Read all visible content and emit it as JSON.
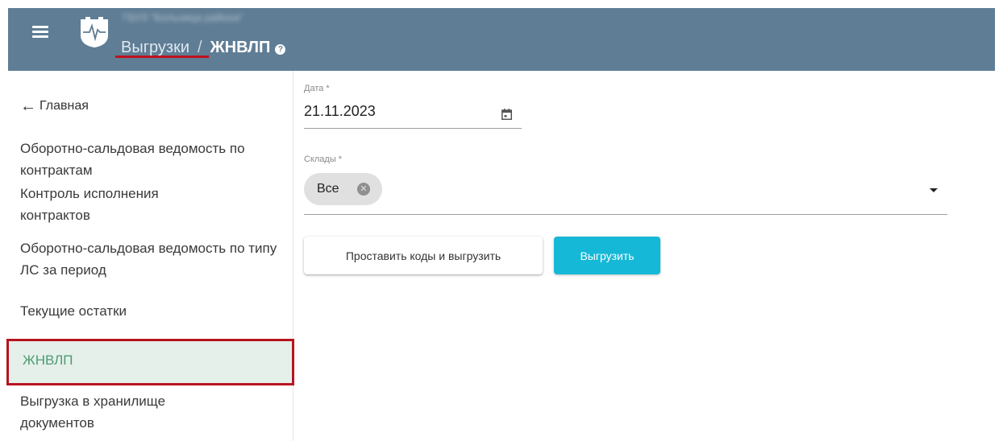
{
  "header": {
    "org_name": "ГБУЗ \"Больница района\"",
    "breadcrumb_parent": "Выгрузки",
    "breadcrumb_separator": "/",
    "breadcrumb_current": "ЖНВЛП",
    "help_symbol": "?",
    "background_color": "#5f7d95",
    "icons": [
      "menu-icon",
      "logo-icon",
      "help-icon"
    ]
  },
  "sidebar": {
    "back_label": "Главная",
    "items": [
      {
        "label": "Оборотно-сальдовая ведомость по контрактам"
      },
      {
        "label": "Контроль исполнения контрактов"
      },
      {
        "label": "Оборотно-сальдовая ведомость по типу ЛС за период"
      },
      {
        "label": "Текущие остатки"
      },
      {
        "label": "ЖНВЛП",
        "active": true
      },
      {
        "label": "Выгрузка в хранилище документов"
      }
    ],
    "active_color": "#4e9b72",
    "active_background": "#e5f0ea"
  },
  "form": {
    "date_label": "Дата *",
    "date_value": "21.11.2023",
    "warehouses_label": "Склады *",
    "warehouse_chip": "Все",
    "chip_remove_symbol": "✕",
    "btn_set_codes": "Проставить коды и выгрузить",
    "btn_export": "Выгрузить",
    "primary_color": "#15b8d6"
  }
}
